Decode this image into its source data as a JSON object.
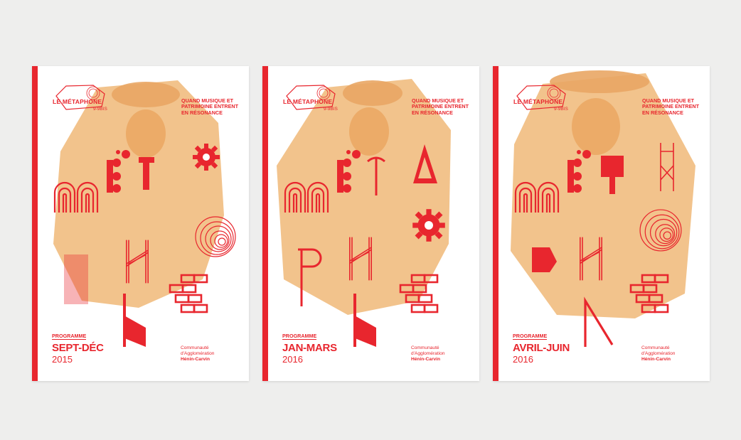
{
  "brand": {
    "logo_title": "LE MÉTAPHONE",
    "logo_sub": "9-9BIS",
    "tagline": "QUAND MUSIQUE ET PATRIMOINE ENTRENT EN RÉSONANCE",
    "programme_label": "PROGRAMME",
    "org_line1": "Communauté",
    "org_line2": "d'Agglomération",
    "org_line3": "Hénin-Carvin"
  },
  "posters": [
    {
      "season": "SEPT-DÉC",
      "year": "2015"
    },
    {
      "season": "JAN-MARS",
      "year": "2016"
    },
    {
      "season": "AVRIL-JUIN",
      "year": "2016"
    }
  ],
  "colors": {
    "red": "#e8262e",
    "photo_tint": "#f0b978",
    "background": "#eeeeed"
  }
}
